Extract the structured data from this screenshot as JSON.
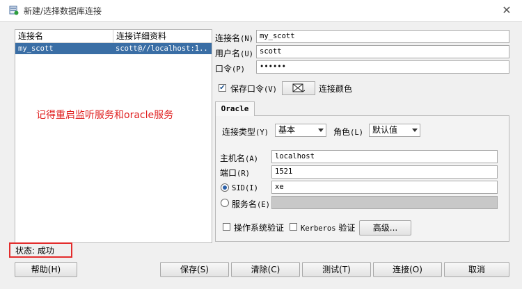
{
  "window": {
    "title": "新建/选择数据库连接"
  },
  "list": {
    "headers": [
      "连接名",
      "连接详细资料"
    ],
    "rows": [
      {
        "name": "my_scott",
        "details": "scott@//localhost:1..."
      }
    ]
  },
  "annotation": "记得重启监听服务和oracle服务",
  "status": "状态: 成功",
  "form": {
    "conn_name_label": "连接名",
    "conn_name_key": "(N)",
    "conn_name_value": "my_scott",
    "user_label": "用户名",
    "user_key": "(U)",
    "user_value": "scott",
    "password_label": "口令",
    "password_key": "(P)",
    "password_value": "••••••",
    "save_pwd_label": "保存口令",
    "save_pwd_key": "(V)",
    "color_label": "连接颜色"
  },
  "oracle": {
    "tab_label": "Oracle",
    "conn_type_label": "连接类型",
    "conn_type_key": "(Y)",
    "conn_type_value": "基本",
    "role_label": "角色",
    "role_key": "(L)",
    "role_value": "默认值",
    "host_label": "主机名",
    "host_key": "(A)",
    "host_value": "localhost",
    "port_label": "端口",
    "port_key": "(R)",
    "port_value": "1521",
    "sid_label": "SID",
    "sid_key": "(I)",
    "sid_value": "xe",
    "service_label": "服务名",
    "service_key": "(E)",
    "os_auth_label": "操作系统验证",
    "kerberos_label": "Kerberos",
    "kerberos_suffix": "验证",
    "advanced_label": "高级..."
  },
  "buttons": {
    "help": "帮助(H)",
    "save": "保存(S)",
    "clear": "清除(C)",
    "test": "测试(T)",
    "connect": "连接(O)",
    "cancel": "取消"
  }
}
